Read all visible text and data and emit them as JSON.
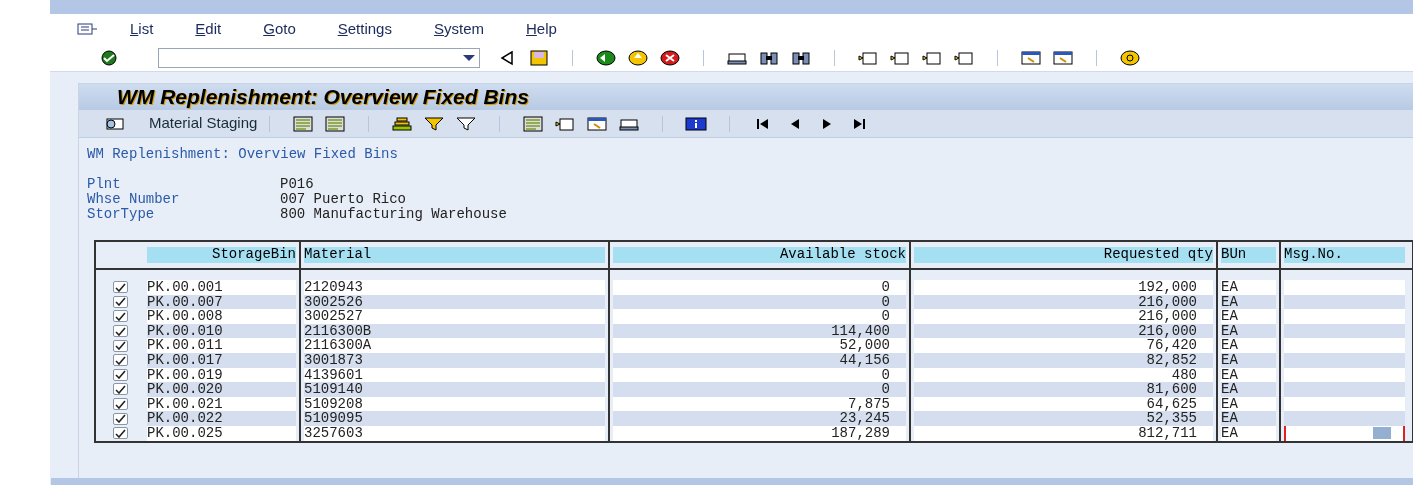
{
  "menu": [
    "List",
    "Edit",
    "Goto",
    "Settings",
    "System",
    "Help"
  ],
  "title": "WM Replenishment: Overview Fixed Bins",
  "app_toolbar": {
    "button": "Material Staging"
  },
  "report": {
    "heading": "WM Replenishment: Overview Fixed Bins",
    "fields": [
      {
        "label": "Plnt",
        "value": "P016"
      },
      {
        "label": "Whse Number",
        "value": "007 Puerto Rico"
      },
      {
        "label": "StorType",
        "value": "800 Manufacturing Warehouse"
      }
    ]
  },
  "table": {
    "columns": [
      "StorageBin",
      "Material",
      "Available stock",
      "Requested qty",
      "BUn",
      "Msg.No."
    ],
    "rows": [
      {
        "checked": true,
        "focused": false,
        "cells": [
          "PK.00.001",
          "2120943",
          "0",
          "192,000",
          "EA"
        ]
      },
      {
        "checked": true,
        "focused": false,
        "cells": [
          "PK.00.007",
          "3002526",
          "0",
          "216,000",
          "EA"
        ]
      },
      {
        "checked": true,
        "focused": false,
        "cells": [
          "PK.00.008",
          "3002527",
          "0",
          "216,000",
          "EA"
        ]
      },
      {
        "checked": true,
        "focused": false,
        "cells": [
          "PK.00.010",
          "2116300B",
          "114,400",
          "216,000",
          "EA"
        ]
      },
      {
        "checked": true,
        "focused": false,
        "cells": [
          "PK.00.011",
          "2116300A",
          "52,000",
          "76,420",
          "EA"
        ]
      },
      {
        "checked": true,
        "focused": false,
        "cells": [
          "PK.00.017",
          "3001873",
          "44,156",
          "82,852",
          "EA"
        ]
      },
      {
        "checked": true,
        "focused": false,
        "cells": [
          "PK.00.019",
          "4139601",
          "0",
          "480",
          "EA"
        ]
      },
      {
        "checked": true,
        "focused": false,
        "cells": [
          "PK.00.020",
          "5109140",
          "0",
          "81,600",
          "EA"
        ]
      },
      {
        "checked": true,
        "focused": false,
        "cells": [
          "PK.00.021",
          "5109208",
          "7,875",
          "64,625",
          "EA"
        ]
      },
      {
        "checked": true,
        "focused": false,
        "cells": [
          "PK.00.022",
          "5109095",
          "23,245",
          "52,355",
          "EA"
        ]
      },
      {
        "checked": true,
        "focused": true,
        "cells": [
          "PK.00.025",
          "3257603",
          "187,289",
          "812,711",
          "EA"
        ]
      }
    ]
  }
}
